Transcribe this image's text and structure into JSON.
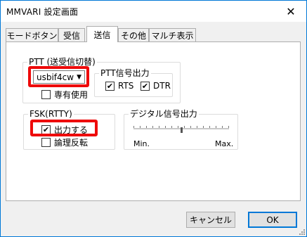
{
  "window": {
    "title": "MMVARI 設定画面",
    "close_glyph": "✕"
  },
  "tabs": [
    {
      "label": "モードボタン",
      "active": false
    },
    {
      "label": "受信",
      "active": false
    },
    {
      "label": "送信",
      "active": true
    },
    {
      "label": "その他",
      "active": false
    },
    {
      "label": "マルチ表示",
      "active": false
    }
  ],
  "ptt": {
    "group_label": "PTT (送受信切替)",
    "port_value": "usbif4cw",
    "exclusive_label": "専有使用",
    "exclusive_checked": false,
    "signal_group_label": "PTT信号出力",
    "rts_label": "RTS",
    "rts_checked": true,
    "dtr_label": "DTR",
    "dtr_checked": true
  },
  "fsk": {
    "group_label": "FSK(RTTY)",
    "output_label": "出力する",
    "output_checked": true,
    "invert_label": "論理反転",
    "invert_checked": false
  },
  "digital": {
    "group_label": "デジタル信号出力",
    "min_label": "Min.",
    "max_label": "Max.",
    "level": 0.5
  },
  "buttons": {
    "cancel": "キャンセル",
    "ok": "OK"
  },
  "check_glyph": "✔",
  "colors": {
    "highlight": "#ee0a0a",
    "accent": "#0078d7"
  }
}
